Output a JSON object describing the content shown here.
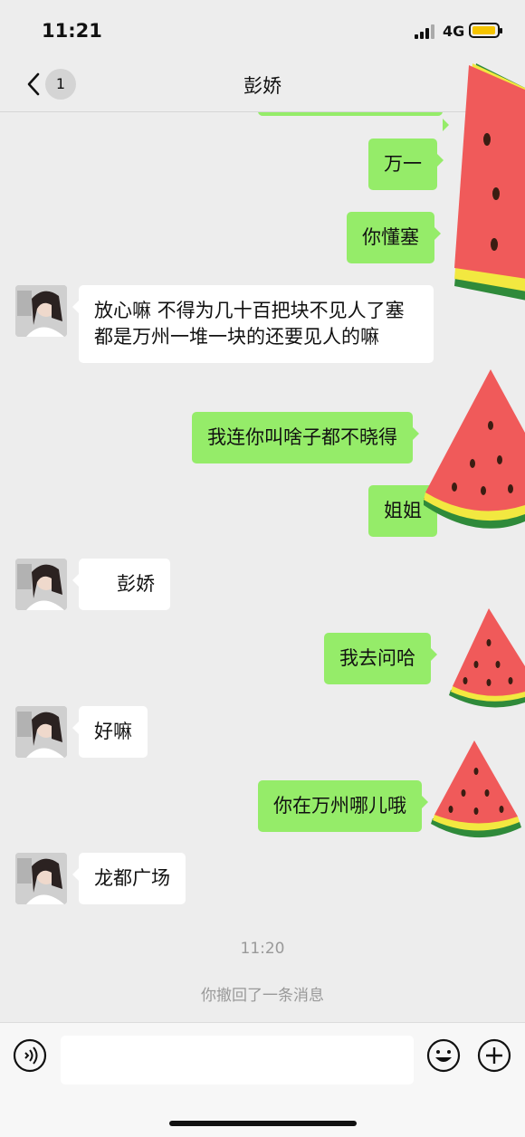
{
  "status_bar": {
    "time": "11:21",
    "network": "4G"
  },
  "nav": {
    "unread_count": "1",
    "title": "彭娇"
  },
  "messages": [
    {
      "side": "out",
      "text": "万一"
    },
    {
      "side": "out",
      "text": "你懂塞"
    },
    {
      "side": "in",
      "text": "放心嘛  不得为几十百把块不见人了塞   都是万州一堆一块的还要见人的嘛"
    },
    {
      "side": "out",
      "text": "我连你叫啥子都不晓得"
    },
    {
      "side": "out",
      "text": "姐姐"
    },
    {
      "side": "in",
      "text": "彭娇"
    },
    {
      "side": "out",
      "text": "我去问哈"
    },
    {
      "side": "in",
      "text": "好嘛"
    },
    {
      "side": "out",
      "text": "你在万州哪儿哦"
    },
    {
      "side": "in",
      "text": "龙都广场"
    }
  ],
  "system": {
    "timestamp": "11:20",
    "recall_notice": "你撤回了一条消息"
  },
  "input_bar": {
    "voice_icon": "voice-icon",
    "emoji_icon": "emoji-icon",
    "more_icon": "plus-icon"
  },
  "colors": {
    "outgoing_bubble": "#95ec69",
    "incoming_bubble": "#ffffff",
    "background": "#ededed"
  }
}
